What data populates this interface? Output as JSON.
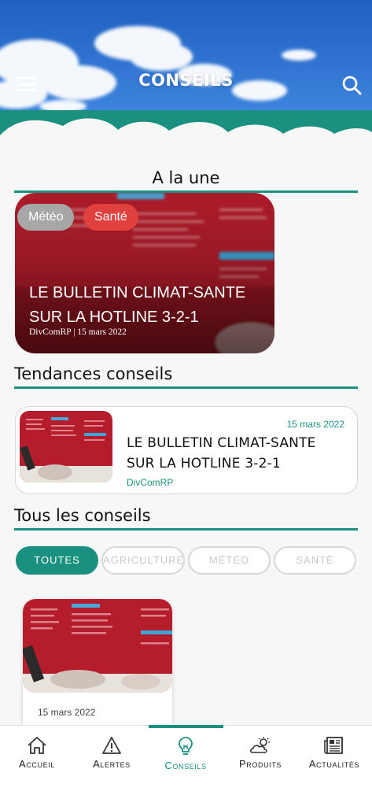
{
  "header": {
    "title": "CONSEILS"
  },
  "sections": {
    "featured": "A la une",
    "trends": "Tendances conseils",
    "all": "Tous les conseils"
  },
  "featured_card": {
    "tags": [
      "Météo",
      "Santé"
    ],
    "title": "LE BULLETIN CLIMAT-SANTE SUR LA HOTLINE 3-2-1",
    "meta": "DivComRP | 15 mars 2022"
  },
  "trend_card": {
    "date": "15 mars 2022",
    "title": "LE BULLETIN CLIMAT-SANTE SUR LA HOTLINE 3-2-1",
    "author": "DivComRP"
  },
  "filters": [
    "TOUTES",
    "AGRICULTURE",
    "MÉTÉO",
    "SANTÉ"
  ],
  "list_card": {
    "date": "15 mars 2022"
  },
  "nav": {
    "items": [
      "Accueil",
      "Alertes",
      "Conseils",
      "Produits",
      "Actualités"
    ],
    "active": "Conseils"
  },
  "colors": {
    "accent": "#1a9080",
    "tag_sante": "#e0403e",
    "tag_meteo": "#a7a7a7"
  }
}
